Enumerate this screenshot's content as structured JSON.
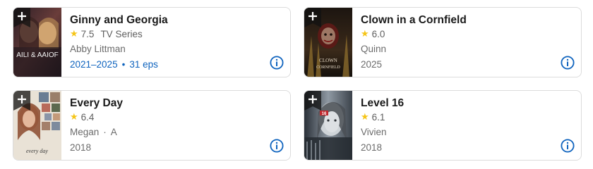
{
  "items": [
    {
      "title": "Ginny and Georgia",
      "rating": "7.5",
      "type": "TV Series",
      "character": "Abby Littman",
      "years": "2021–2025",
      "episodes": "31 eps",
      "poster_text": "AILI & AAIOF"
    },
    {
      "title": "Clown in a Cornfield",
      "rating": "6.0",
      "character": "Quinn",
      "year": "2025",
      "poster_text_top": "CLOWN",
      "poster_text_bottom": "CORNFIELD"
    },
    {
      "title": "Every Day",
      "rating": "6.4",
      "character": "Megan",
      "character_extra": "A",
      "year": "2018",
      "poster_text": "every day"
    },
    {
      "title": "Level 16",
      "rating": "6.1",
      "character": "Vivien",
      "year": "2018",
      "poster_text": "16"
    }
  ],
  "icons": {
    "add": "plus-icon",
    "info": "info-icon",
    "star": "star-icon"
  },
  "colors": {
    "star": "#f5c518",
    "link": "#0e63be",
    "info": "#0e63be"
  }
}
